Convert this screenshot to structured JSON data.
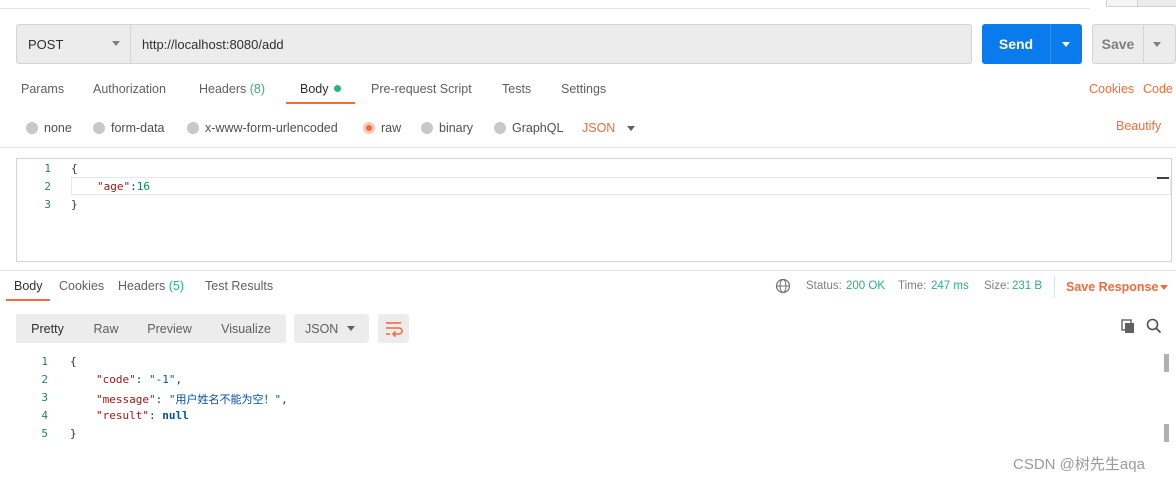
{
  "request": {
    "method": "POST",
    "url": "http://localhost:8080/add",
    "send_label": "Send",
    "save_label": "Save"
  },
  "request_tabs": {
    "params": "Params",
    "authorization": "Authorization",
    "headers": "Headers",
    "headers_count": "(8)",
    "body": "Body",
    "prerequest": "Pre-request Script",
    "tests": "Tests",
    "settings": "Settings",
    "cookies": "Cookies",
    "code": "Code"
  },
  "body_types": {
    "none": "none",
    "form_data": "form-data",
    "urlencoded": "x-www-form-urlencoded",
    "raw": "raw",
    "binary": "binary",
    "graphql": "GraphQL",
    "format": "JSON",
    "beautify": "Beautify"
  },
  "request_body": {
    "line_numbers": [
      "1",
      "2",
      "3"
    ],
    "open_brace": "{",
    "key": "\"age\"",
    "colon": ":",
    "value": "16",
    "close_brace": "}"
  },
  "response_tabs": {
    "body": "Body",
    "cookies": "Cookies",
    "headers": "Headers",
    "headers_count": "(5)",
    "test_results": "Test Results"
  },
  "response_status": {
    "status_label": "Status:",
    "status_value": "200 OK",
    "time_label": "Time:",
    "time_value": "247 ms",
    "size_label": "Size:",
    "size_value": "231 B",
    "save_response": "Save Response"
  },
  "response_view": {
    "pretty": "Pretty",
    "raw": "Raw",
    "preview": "Preview",
    "visualize": "Visualize",
    "format": "JSON"
  },
  "response_body": {
    "line_numbers": [
      "1",
      "2",
      "3",
      "4",
      "5"
    ],
    "open_brace": "{",
    "code_key": "\"code\"",
    "code_value": "\"-1\"",
    "message_key": "\"message\"",
    "message_value": "\"用户姓名不能为空！\"",
    "result_key": "\"result\"",
    "result_value": "null",
    "close_brace": "}"
  },
  "watermark": "CSDN @树先生aqa",
  "colors": {
    "accent": "#f26b3a",
    "send": "#097bed",
    "success": "#26b47f"
  }
}
